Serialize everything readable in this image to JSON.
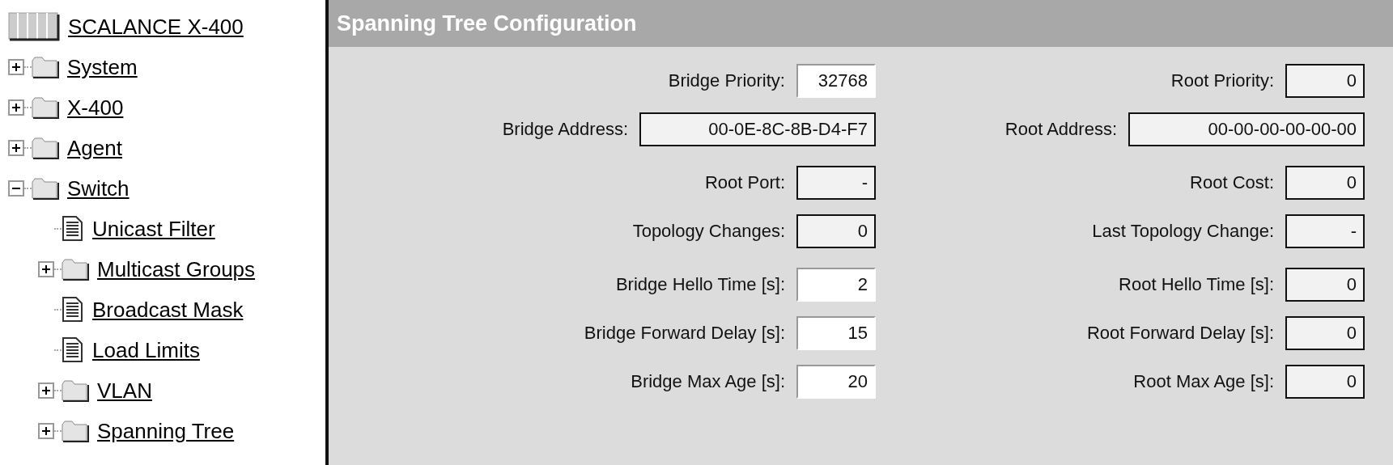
{
  "tree": {
    "label": "SCALANCE X-400",
    "kind": "device",
    "children": [
      {
        "label": "System",
        "kind": "folder",
        "expanded": false
      },
      {
        "label": "X-400",
        "kind": "folder",
        "expanded": false
      },
      {
        "label": "Agent",
        "kind": "folder",
        "expanded": false
      },
      {
        "label": "Switch",
        "kind": "folder",
        "expanded": true,
        "children": [
          {
            "label": "Unicast Filter",
            "kind": "page"
          },
          {
            "label": "Multicast Groups",
            "kind": "folder",
            "expanded": false
          },
          {
            "label": "Broadcast Mask",
            "kind": "page"
          },
          {
            "label": "Load Limits",
            "kind": "page"
          },
          {
            "label": "VLAN",
            "kind": "folder",
            "expanded": false
          },
          {
            "label": "Spanning Tree",
            "kind": "folder",
            "expanded": false
          }
        ]
      }
    ]
  },
  "panel": {
    "title": "Spanning Tree Configuration",
    "columns": [
      {
        "groups": [
          {
            "fields": [
              {
                "label": "Bridge Priority:",
                "value": "32768",
                "readonly": false,
                "kind": "number"
              },
              {
                "label": "Bridge Address:",
                "value": "00-0E-8C-8B-D4-F7",
                "readonly": true,
                "kind": "address"
              }
            ]
          },
          {
            "fields": [
              {
                "label": "Root Port:",
                "value": "-",
                "readonly": true,
                "kind": "number"
              },
              {
                "label": "Topology Changes:",
                "value": "0",
                "readonly": true,
                "kind": "number"
              }
            ]
          },
          {
            "fields": [
              {
                "label": "Bridge Hello Time [s]:",
                "value": "2",
                "readonly": false,
                "kind": "number"
              },
              {
                "label": "Bridge Forward Delay [s]:",
                "value": "15",
                "readonly": false,
                "kind": "number"
              },
              {
                "label": "Bridge Max Age [s]:",
                "value": "20",
                "readonly": false,
                "kind": "number"
              }
            ]
          }
        ]
      },
      {
        "groups": [
          {
            "fields": [
              {
                "label": "Root Priority:",
                "value": "0",
                "readonly": true,
                "kind": "number"
              },
              {
                "label": "Root Address:",
                "value": "00-00-00-00-00-00",
                "readonly": true,
                "kind": "address"
              }
            ]
          },
          {
            "fields": [
              {
                "label": "Root Cost:",
                "value": "0",
                "readonly": true,
                "kind": "number"
              },
              {
                "label": "Last Topology Change:",
                "value": "-",
                "readonly": true,
                "kind": "number"
              }
            ]
          },
          {
            "fields": [
              {
                "label": "Root Hello Time [s]:",
                "value": "0",
                "readonly": true,
                "kind": "number"
              },
              {
                "label": "Root Forward Delay [s]:",
                "value": "0",
                "readonly": true,
                "kind": "number"
              },
              {
                "label": "Root Max Age [s]:",
                "value": "0",
                "readonly": true,
                "kind": "number"
              }
            ]
          }
        ]
      }
    ]
  }
}
